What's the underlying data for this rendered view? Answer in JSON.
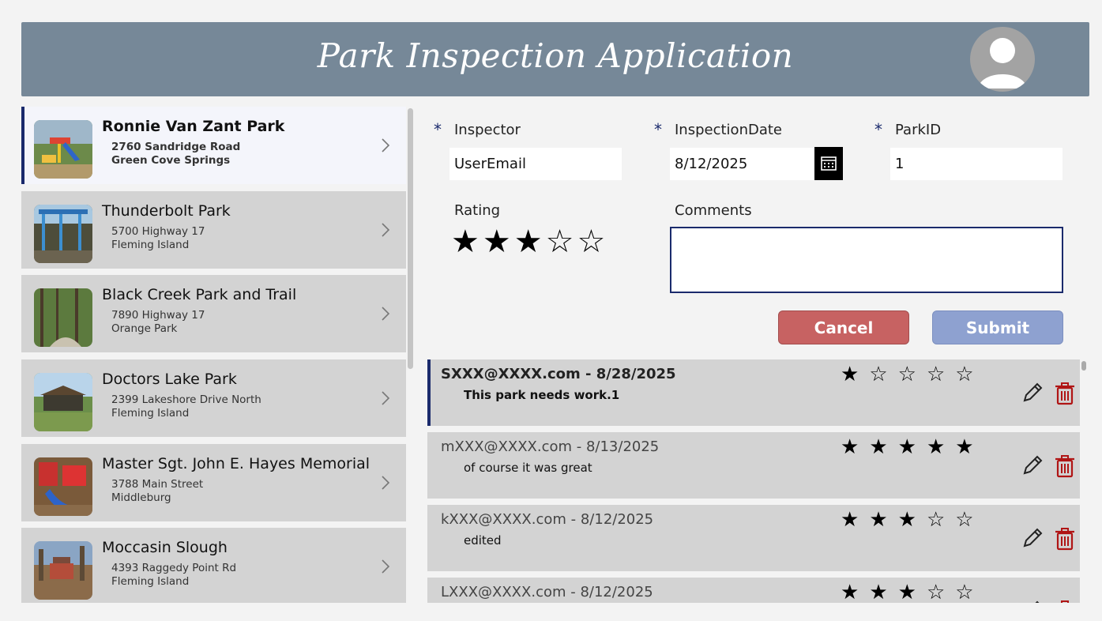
{
  "header": {
    "title": "Park Inspection Application",
    "avatar_icon": "user-avatar-icon"
  },
  "parks": [
    {
      "name": "Ronnie Van Zant Park",
      "address": "2760 Sandridge Road",
      "city": "Green Cove Springs",
      "selected": true
    },
    {
      "name": "Thunderbolt Park",
      "address": "5700 Highway 17",
      "city": "Fleming Island"
    },
    {
      "name": "Black Creek Park and Trail",
      "address": "7890 Highway 17",
      "city": "Orange Park"
    },
    {
      "name": "Doctors Lake Park",
      "address": "2399 Lakeshore Drive North",
      "city": "Fleming Island"
    },
    {
      "name": "Master Sgt. John E. Hayes Memorial",
      "address": "3788 Main Street",
      "city": "Middleburg"
    },
    {
      "name": "Moccasin Slough",
      "address": "4393 Raggedy Point Rd",
      "city": "Fleming Island"
    }
  ],
  "form": {
    "required_mark": "*",
    "inspector_label": "Inspector",
    "inspector_value": "UserEmail",
    "date_label": "InspectionDate",
    "date_value": "8/12/2025",
    "parkid_label": "ParkID",
    "parkid_value": "1",
    "rating_label": "Rating",
    "rating_value": 3,
    "rating_max": 5,
    "comments_label": "Comments",
    "comments_value": "",
    "cancel_label": "Cancel",
    "submit_label": "Submit"
  },
  "reviews": [
    {
      "who": "SXXX@XXXX.com - 8/28/2025",
      "comment": "This park needs work.1",
      "rating": 1,
      "selected": true
    },
    {
      "who": "mXXX@XXXX.com - 8/13/2025",
      "comment": "of course it was great",
      "rating": 5
    },
    {
      "who": "kXXX@XXXX.com - 8/12/2025",
      "comment": "edited",
      "rating": 3
    },
    {
      "who": "LXXX@XXXX.com - 8/12/2025",
      "comment": "",
      "rating": 3
    }
  ],
  "colors": {
    "header": "#768898",
    "accent": "#1a2a6c",
    "cancel": "#c76262",
    "submit": "#8ea1d0",
    "delete_icon": "#b01515"
  }
}
